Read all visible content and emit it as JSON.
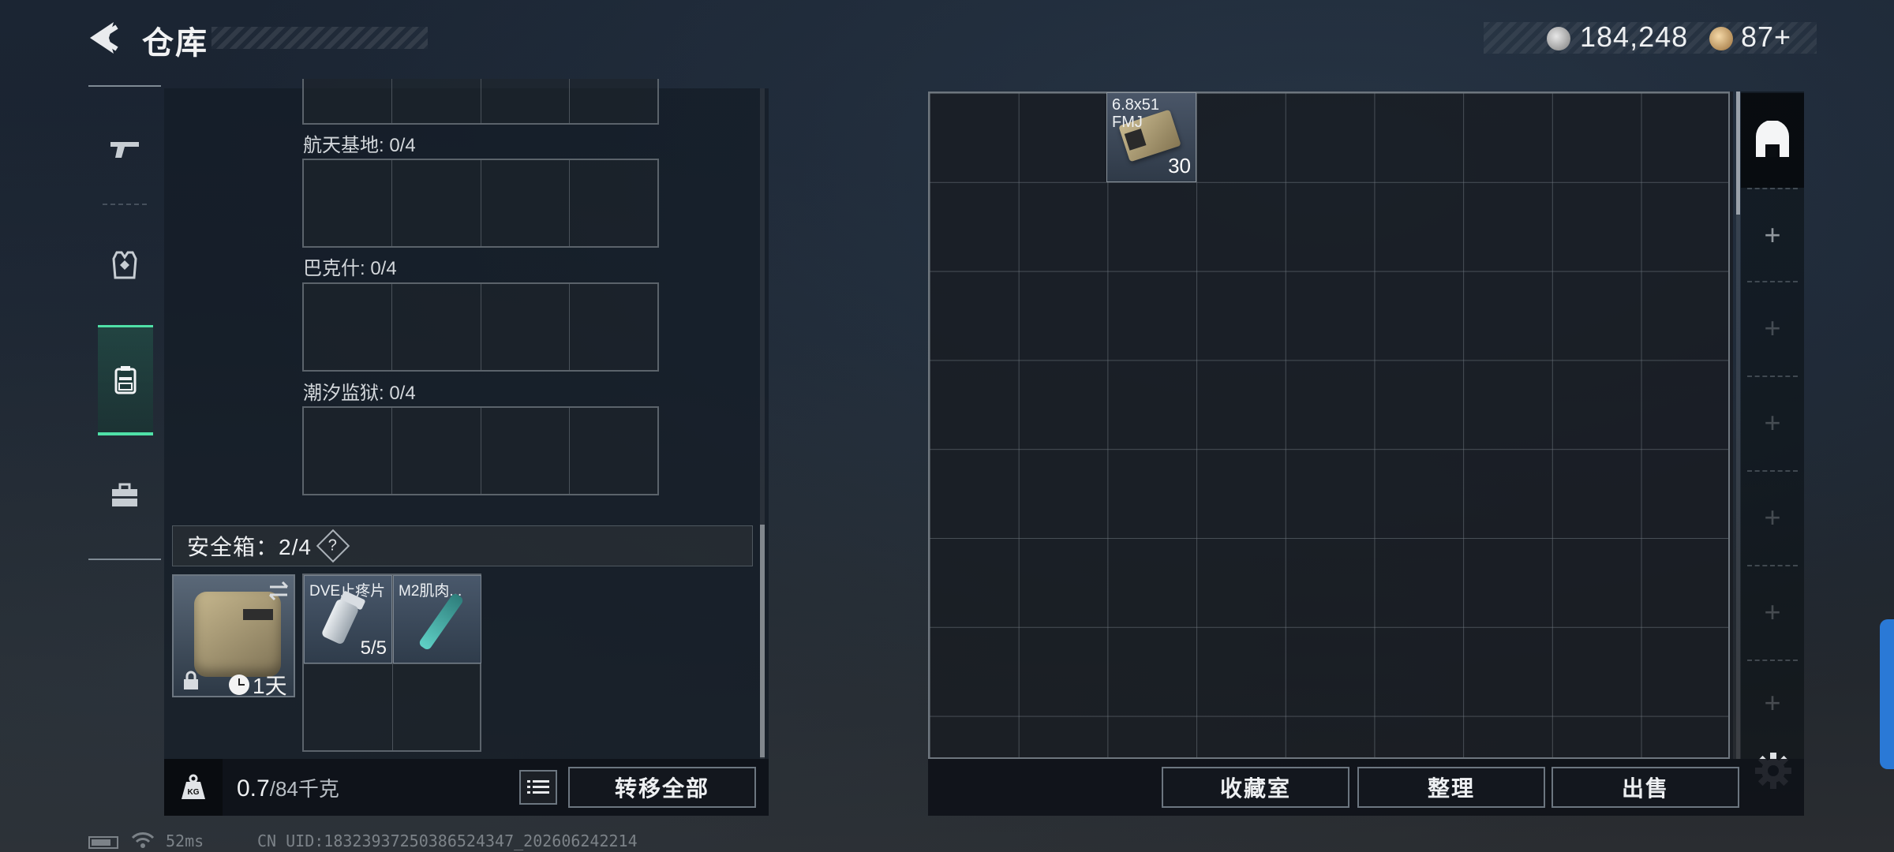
{
  "header": {
    "title": "仓库",
    "currency1": "184,248",
    "currency2": "87+"
  },
  "left_nav": {
    "items": [
      {
        "name": "weapon",
        "icon": "pistol-icon"
      },
      {
        "name": "equipment",
        "icon": "vest-icon"
      },
      {
        "name": "backpack",
        "icon": "backpack-icon",
        "active": true
      },
      {
        "name": "toolbox",
        "icon": "toolbox-icon"
      }
    ]
  },
  "containers": [
    {
      "label": "航天基地: 0/4"
    },
    {
      "label": "巴克什: 0/4"
    },
    {
      "label": "潮汐监狱: 0/4"
    }
  ],
  "safebox": {
    "label": "安全箱：2/4",
    "help": "?",
    "timer": "1天",
    "items": [
      {
        "name": "DVE止疼片",
        "count": "5/5"
      },
      {
        "name": "M2肌肉..."
      }
    ]
  },
  "weight": {
    "current": "0.7",
    "capacity": "/84千克"
  },
  "left_actions": {
    "transfer_all": "转移全部"
  },
  "storage": {
    "items": [
      {
        "name": "6.8x51 FMJ",
        "count": "30"
      }
    ]
  },
  "right_actions": {
    "collection_room": "收藏室",
    "sort": "整理",
    "sell": "出售"
  },
  "status": {
    "ping": "52ms",
    "uid": "CN UID:18323937250386524347_202606242214"
  },
  "colors": {
    "accent": "#4fe0a7",
    "side_tab": "#2a79d6"
  }
}
